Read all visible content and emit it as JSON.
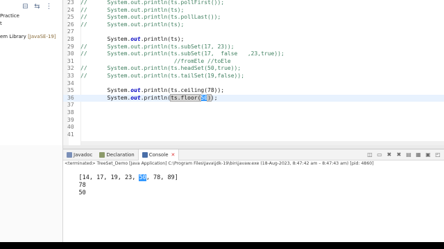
{
  "explorer": {
    "toolbar_icons": [
      "collapse-all-icon",
      "link-editor-icon",
      "view-menu-icon"
    ],
    "items": [
      {
        "label": "Practice",
        "extra": ""
      },
      {
        "label": "t",
        "extra": ""
      },
      {
        "label": "em Library ",
        "extra": "[JavaSE-19]"
      }
    ]
  },
  "editor": {
    "lines": [
      {
        "n": "23",
        "segments": [
          {
            "t": "//      System.out.println(ts.pollFirst());",
            "c": "cm"
          }
        ]
      },
      {
        "n": "24",
        "segments": [
          {
            "t": "//      System.out.println(ts);",
            "c": "cm"
          }
        ]
      },
      {
        "n": "25",
        "segments": [
          {
            "t": "//      System.out.println(ts.pollLast());",
            "c": "cm"
          }
        ]
      },
      {
        "n": "26",
        "segments": [
          {
            "t": "//      System.out.println(ts);",
            "c": "cm"
          }
        ]
      },
      {
        "n": "27",
        "segments": [
          {
            "t": "",
            "c": ""
          }
        ]
      },
      {
        "n": "28",
        "segments": [
          {
            "t": "        System.",
            "c": ""
          },
          {
            "t": "out",
            "c": "kw"
          },
          {
            "t": ".println(ts);",
            "c": ""
          }
        ]
      },
      {
        "n": "29",
        "segments": [
          {
            "t": "//      System.out.println(ts.subSet(17, 23));",
            "c": "cm"
          }
        ]
      },
      {
        "n": "30",
        "segments": [
          {
            "t": "//      System.out.println(ts.subSet(17,  false   ,23,true));",
            "c": "cm"
          }
        ]
      },
      {
        "n": "31",
        "segments": [
          {
            "t": "                            //fromEle //toEle",
            "c": "cm"
          }
        ]
      },
      {
        "n": "32",
        "segments": [
          {
            "t": "//      System.out.println(ts.headSet(50,true));",
            "c": "cm"
          }
        ]
      },
      {
        "n": "33",
        "segments": [
          {
            "t": "//      System.out.println(ts.tailSet(19,false));",
            "c": "cm"
          }
        ]
      },
      {
        "n": "34",
        "segments": [
          {
            "t": "",
            "c": ""
          }
        ]
      },
      {
        "n": "35",
        "segments": [
          {
            "t": "        System.",
            "c": ""
          },
          {
            "t": "out",
            "c": "kw"
          },
          {
            "t": ".println(ts.ceiling(78));",
            "c": ""
          }
        ]
      },
      {
        "n": "36",
        "segments": [
          {
            "t": "        System.",
            "c": ""
          },
          {
            "t": "out",
            "c": "kw"
          },
          {
            "t": ".println(",
            "c": ""
          },
          {
            "t": "ts.floor(",
            "c": "hl"
          },
          {
            "t": "50",
            "c": "sel"
          },
          {
            "t": ")",
            "c": "hl"
          },
          {
            "t": ");",
            "c": ""
          }
        ]
      },
      {
        "n": "37",
        "segments": [
          {
            "t": "",
            "c": ""
          }
        ]
      },
      {
        "n": "38",
        "segments": [
          {
            "t": "",
            "c": ""
          }
        ]
      },
      {
        "n": "39",
        "segments": [
          {
            "t": "",
            "c": ""
          }
        ]
      },
      {
        "n": "40",
        "segments": [
          {
            "t": "",
            "c": ""
          }
        ]
      },
      {
        "n": "41",
        "segments": [
          {
            "t": "",
            "c": ""
          }
        ]
      }
    ],
    "current_line": "36"
  },
  "console": {
    "tabs": [
      {
        "label": "Javadoc",
        "icon": "javadoc-icon"
      },
      {
        "label": "Declaration",
        "icon": "declaration-icon"
      },
      {
        "label": "Console",
        "icon": "console-icon"
      }
    ],
    "toolbar_icons": [
      "pin-icon",
      "display-selected-icon",
      "remove-launch-icon",
      "remove-all-icon",
      "scroll-lock-icon",
      "word-wrap-icon",
      "open-console-icon",
      "new-console-icon"
    ],
    "terminated": "<terminated> TreeSet_Demo [Java Application] C:\\Program Files\\Java\\jdk-19\\bin\\javaw.exe  (18-Aug-2023, 8:47:42 am – 8:47:43 am) [pid: 4860]",
    "output": [
      {
        "before": "[14, 17, 19, 23, ",
        "sel": "50",
        "after": ", 78, 89]"
      },
      {
        "before": "78",
        "sel": "",
        "after": ""
      },
      {
        "before": "50",
        "sel": "",
        "after": ""
      }
    ]
  },
  "colors": {
    "comment": "#3f7f5f",
    "keyword": "#0000c0",
    "selection": "#3399ff",
    "current_line": "#e8f2fe"
  }
}
